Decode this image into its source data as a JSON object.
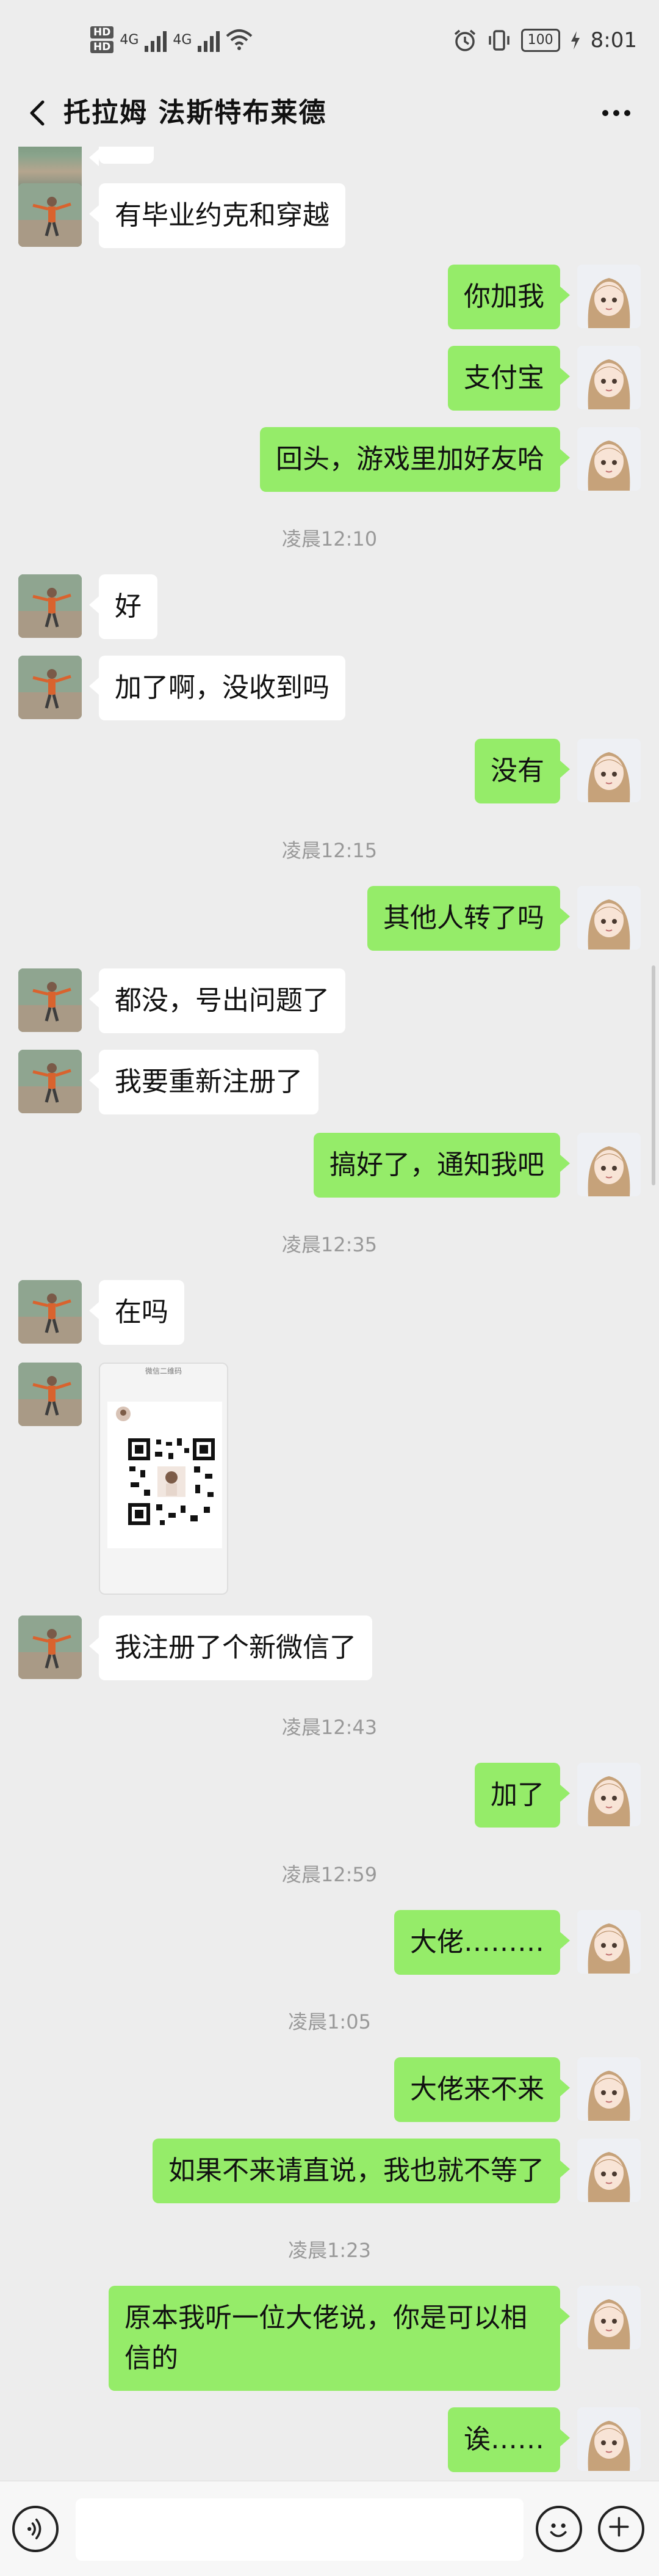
{
  "status_bar": {
    "hd1": "HD",
    "hd2": "HD",
    "net1": "4G",
    "net2": "4G",
    "battery": "100",
    "time": "8:01"
  },
  "header": {
    "title": "托拉姆  法斯特布莱德"
  },
  "messages": [
    {
      "type": "text",
      "side": "left",
      "text": "有毕业约克和穿越"
    },
    {
      "type": "text",
      "side": "right",
      "text": "你加我"
    },
    {
      "type": "text",
      "side": "right",
      "text": "支付宝"
    },
    {
      "type": "text",
      "side": "right",
      "text": "回头，游戏里加好友哈"
    },
    {
      "type": "time",
      "text": "凌晨12:10"
    },
    {
      "type": "text",
      "side": "left",
      "text": "好"
    },
    {
      "type": "text",
      "side": "left",
      "text": "加了啊，没收到吗"
    },
    {
      "type": "text",
      "side": "right",
      "text": "没有"
    },
    {
      "type": "time",
      "text": "凌晨12:15"
    },
    {
      "type": "text",
      "side": "right",
      "text": "其他人转了吗"
    },
    {
      "type": "text",
      "side": "left",
      "text": "都没，号出问题了"
    },
    {
      "type": "text",
      "side": "left",
      "text": "我要重新注册了"
    },
    {
      "type": "text",
      "side": "right",
      "text": "搞好了，通知我吧"
    },
    {
      "type": "time",
      "text": "凌晨12:35"
    },
    {
      "type": "text",
      "side": "left",
      "text": "在吗"
    },
    {
      "type": "image",
      "side": "left",
      "label": "微信二维码"
    },
    {
      "type": "text",
      "side": "left",
      "text": "我注册了个新微信了"
    },
    {
      "type": "time",
      "text": "凌晨12:43"
    },
    {
      "type": "text",
      "side": "right",
      "text": "加了"
    },
    {
      "type": "time",
      "text": "凌晨12:59"
    },
    {
      "type": "text",
      "side": "right",
      "text": "大佬………"
    },
    {
      "type": "time",
      "text": "凌晨1:05"
    },
    {
      "type": "text",
      "side": "right",
      "text": "大佬来不来"
    },
    {
      "type": "text",
      "side": "right",
      "text": "如果不来请直说，我也就不等了"
    },
    {
      "type": "time",
      "text": "凌晨1:23"
    },
    {
      "type": "text",
      "side": "right",
      "text": "原本我听一位大佬说，你是可以相信的"
    },
    {
      "type": "text",
      "side": "right",
      "text": "诶……"
    }
  ],
  "input_bar": {
    "placeholder": ""
  }
}
